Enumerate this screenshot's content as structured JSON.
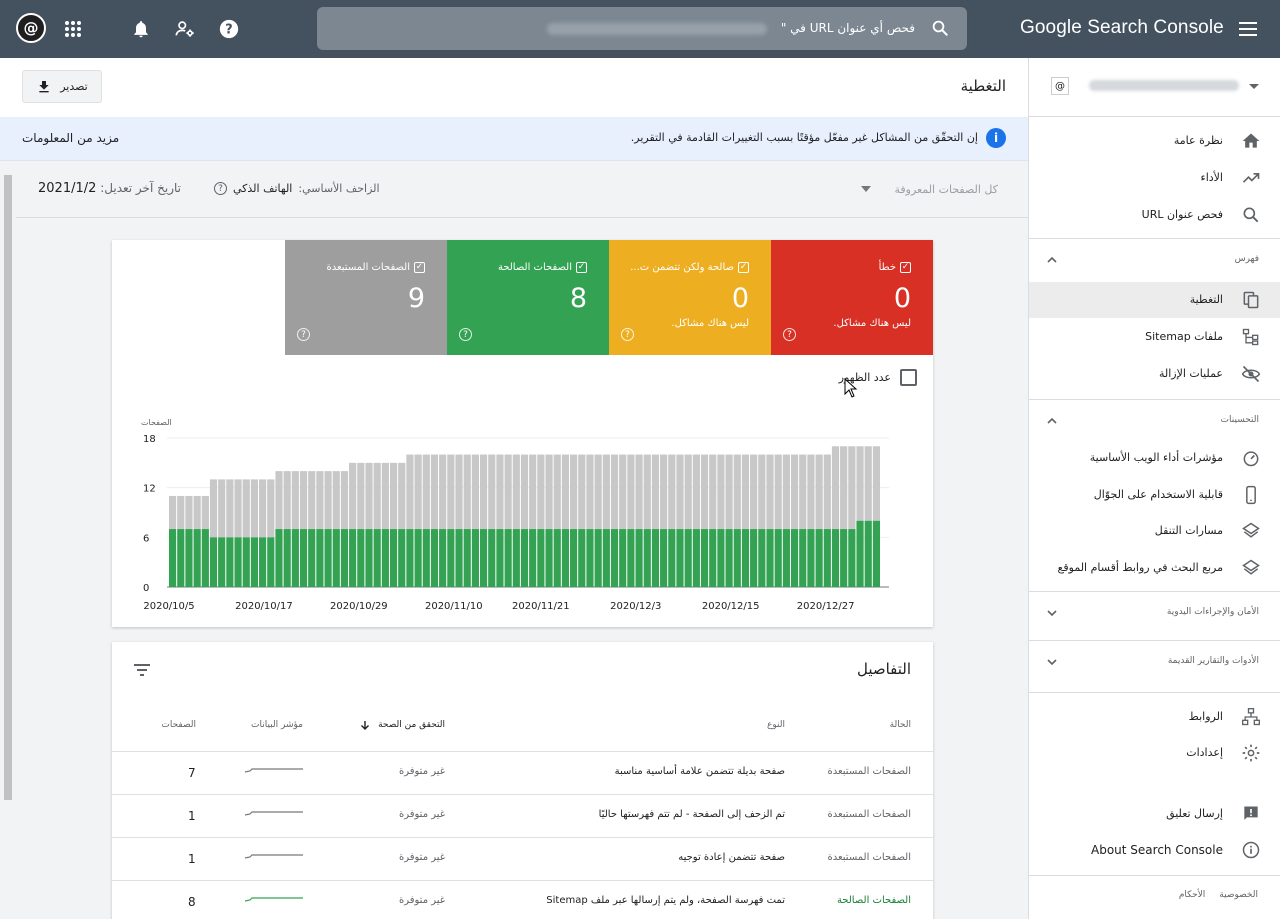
{
  "topbar": {
    "brand": "Google Search Console",
    "search_placeholder": "فحص أي عنوان URL في \"",
    "icons": [
      "menu-icon",
      "search-icon",
      "help-icon",
      "users-settings-icon",
      "bell-icon",
      "apps-grid-icon",
      "account-avatar"
    ]
  },
  "header": {
    "title": "التغطية",
    "export_label": "تصدير"
  },
  "info": {
    "text": "إن التحقّق من المشاكل غير مفعّل مؤقتًا بسبب التغييرات القادمة في التقرير.",
    "link": "مزيد من المعلومات"
  },
  "filter": {
    "pages": "كل الصفحات المعروفة",
    "crawler_label": "الزاحف الأساسي:",
    "crawler_value": "الهاتف الذكي",
    "updated_label": "تاريخ آخر تعديل:",
    "updated_value": "2021/1/2"
  },
  "summary": {
    "tiles": [
      {
        "label": "خطأ",
        "value": "0",
        "sub": "ليس هناك مشاكل.",
        "color": "#d93025"
      },
      {
        "label": "صالحة ولكن تتضمن ت...",
        "value": "0",
        "sub": "ليس هناك مشاكل.",
        "color": "#edaf21"
      },
      {
        "label": "الصفحات الصالحة",
        "value": "8",
        "sub": "",
        "color": "#33a353"
      },
      {
        "label": "الصفحات المستبعدة",
        "value": "9",
        "sub": "",
        "color": "#9e9e9e"
      }
    ],
    "impressions_label": "عدد الظهور"
  },
  "chart_data": {
    "type": "bar",
    "stacked": true,
    "ylabel": "الصفحات",
    "ylim": [
      0,
      18
    ],
    "yticks": [
      0,
      6,
      12,
      18
    ],
    "xticks": [
      "2020/10/5",
      "2020/10/17",
      "2020/10/29",
      "2020/11/10",
      "2020/11/21",
      "2020/12/3",
      "2020/12/15",
      "2020/12/27"
    ],
    "x_start": "2020/10/5",
    "x_end": "2021/1/2",
    "colors": {
      "valid": "#33a353",
      "excluded": "#c8c8c8"
    },
    "series": [
      {
        "name": "الصفحات الصالحة",
        "values": [
          7,
          7,
          7,
          7,
          7,
          6,
          6,
          6,
          6,
          6,
          6,
          6,
          6,
          7,
          7,
          7,
          7,
          7,
          7,
          7,
          7,
          7,
          7,
          7,
          7,
          7,
          7,
          7,
          7,
          7,
          7,
          7,
          7,
          7,
          7,
          7,
          7,
          7,
          7,
          7,
          7,
          7,
          7,
          7,
          7,
          7,
          7,
          7,
          7,
          7,
          7,
          7,
          7,
          7,
          7,
          7,
          7,
          7,
          7,
          7,
          7,
          7,
          7,
          7,
          7,
          7,
          7,
          7,
          7,
          7,
          7,
          7,
          7,
          7,
          7,
          7,
          7,
          7,
          7,
          7,
          7,
          7,
          7,
          7,
          8,
          8,
          8
        ]
      },
      {
        "name": "الصفحات المستبعدة",
        "values": [
          4,
          4,
          4,
          4,
          4,
          7,
          7,
          7,
          7,
          7,
          7,
          7,
          7,
          7,
          7,
          7,
          7,
          7,
          7,
          7,
          7,
          7,
          8,
          8,
          8,
          8,
          8,
          8,
          8,
          9,
          9,
          9,
          9,
          9,
          9,
          9,
          9,
          9,
          9,
          9,
          9,
          9,
          9,
          9,
          9,
          9,
          9,
          9,
          9,
          9,
          9,
          9,
          9,
          9,
          9,
          9,
          9,
          9,
          9,
          9,
          9,
          9,
          9,
          9,
          9,
          9,
          9,
          9,
          9,
          9,
          9,
          9,
          9,
          9,
          9,
          9,
          9,
          9,
          9,
          9,
          9,
          10,
          10,
          10,
          9,
          9,
          9
        ]
      }
    ]
  },
  "details": {
    "title": "التفاصيل",
    "columns": {
      "status": "الحالة",
      "type": "النوع",
      "validation": "التحقق من الصحة",
      "trend": "مؤشر البيانات",
      "pages": "الصفحات"
    },
    "rows": [
      {
        "status": "الصفحات المستبعدة",
        "type": "صفحة بديلة تتضمن علامة أساسية مناسبة",
        "validation": "غير متوفرة",
        "pages": "7",
        "valid": false
      },
      {
        "status": "الصفحات المستبعدة",
        "type": "تم الزحف إلى الصفحة - لم تتم فهرستها حاليًا",
        "validation": "غير متوفرة",
        "pages": "1",
        "valid": false
      },
      {
        "status": "الصفحات المستبعدة",
        "type": "صفحة تتضمن إعادة توجيه",
        "validation": "غير متوفرة",
        "pages": "1",
        "valid": false
      },
      {
        "status": "الصفحات الصالحة",
        "type": "تمت فهرسة الصفحة، ولم يتم إرسالها عبر ملف Sitemap",
        "validation": "غير متوفرة",
        "pages": "8",
        "valid": true
      }
    ]
  },
  "sidebar": {
    "items_top": [
      {
        "label": "نظرة عامة",
        "icon": "home-icon"
      },
      {
        "label": "الأداء",
        "icon": "trending-up-icon"
      },
      {
        "label": "فحص عنوان URL",
        "icon": "search-icon"
      }
    ],
    "index_header": "فهرس",
    "index_items": [
      {
        "label": "التغطية",
        "icon": "copy-icon",
        "active": true
      },
      {
        "label": "ملفات Sitemap",
        "icon": "sitemap-icon"
      },
      {
        "label": "عمليات الإزالة",
        "icon": "eye-off-icon"
      }
    ],
    "enh_header": "التحسينات",
    "enh_items": [
      {
        "label": "مؤشرات أداء الويب الأساسية",
        "icon": "speed-icon"
      },
      {
        "label": "قابلية الاستخدام على الجوّال",
        "icon": "phone-icon"
      },
      {
        "label": "مسارات التنقل",
        "icon": "layers-icon"
      },
      {
        "label": "مربع البحث في روابط أقسام الموقع",
        "icon": "layers-icon"
      }
    ],
    "security_header": "الأمان والإجراءات اليدوية",
    "legacy_header": "الأدوات والتقارير القديمة",
    "bottom_items": [
      {
        "label": "الروابط",
        "icon": "links-icon"
      },
      {
        "label": "إعدادات",
        "icon": "gear-icon"
      }
    ],
    "feedback": "إرسال تعليق",
    "about": "About Search Console",
    "footer": {
      "privacy": "الخصوصية",
      "terms": "الأحكام"
    }
  }
}
